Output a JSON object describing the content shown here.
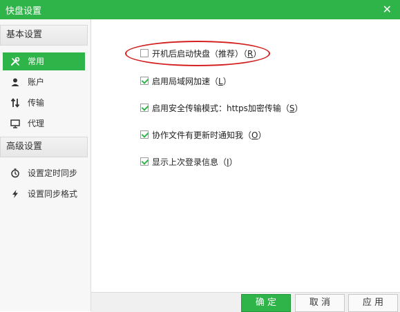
{
  "window": {
    "title": "快盘设置"
  },
  "sidebar": {
    "basic_header": "基本设置",
    "basic_items": [
      {
        "label": "常用",
        "icon": "tools-icon",
        "active": true
      },
      {
        "label": "账户",
        "icon": "user-icon"
      },
      {
        "label": "传输",
        "icon": "transfer-arrows-icon"
      },
      {
        "label": "代理",
        "icon": "monitor-icon"
      }
    ],
    "advanced_header": "高级设置",
    "advanced_items": [
      {
        "label": "设置定时同步",
        "icon": "timer-icon"
      },
      {
        "label": "设置同步格式",
        "icon": "lightning-icon"
      }
    ]
  },
  "options": [
    {
      "text": "开机后启动快盘（推荐）（",
      "key": "R",
      "end": "）",
      "checked": false
    },
    {
      "text": "启用局域网加速（",
      "key": "L",
      "end": "）",
      "checked": true
    },
    {
      "text": "启用安全传输模式：https加密传输（",
      "key": "S",
      "end": "）",
      "checked": true
    },
    {
      "text": "协作文件有更新时通知我（",
      "key": "O",
      "end": "）",
      "checked": true
    },
    {
      "text": "显示上次登录信息（",
      "key": "I",
      "end": "）",
      "checked": true
    }
  ],
  "footer": {
    "ok": "确 定",
    "cancel": "取 消",
    "apply": "应 用"
  },
  "colors": {
    "accent": "#2fb44a",
    "highlight": "#d42020"
  }
}
